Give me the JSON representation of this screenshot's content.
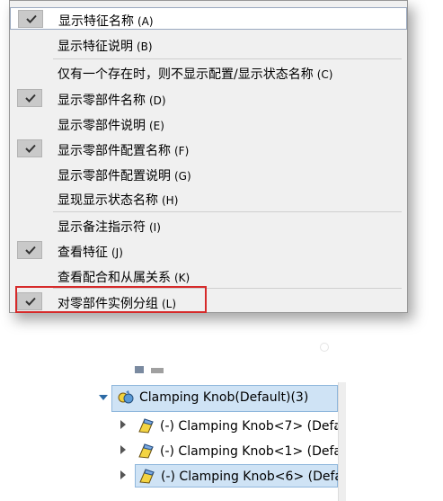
{
  "menu": {
    "items": [
      {
        "label": "显示特征名称",
        "accel": "(A)",
        "checked": true,
        "hover": true
      },
      {
        "label": "显示特征说明",
        "accel": "(B)",
        "checked": false
      },
      {
        "label": "仅有一个存在时，则不显示配置/显示状态名称",
        "accel": "(C)",
        "checked": false
      },
      {
        "label": "显示零部件名称",
        "accel": "(D)",
        "checked": true
      },
      {
        "label": "显示零部件说明",
        "accel": "(E)",
        "checked": false
      },
      {
        "label": "显示零部件配置名称",
        "accel": "(F)",
        "checked": true
      },
      {
        "label": "显示零部件配置说明",
        "accel": "(G)",
        "checked": false
      },
      {
        "label": "显现显示状态名称",
        "accel": "(H)",
        "checked": false
      },
      {
        "label": "显示备注指示符",
        "accel": "(I)",
        "checked": false
      },
      {
        "label": "查看特征",
        "accel": "(J)",
        "checked": true
      },
      {
        "label": "查看配合和从属关系",
        "accel": "(K)",
        "checked": false
      },
      {
        "label": "对零部件实例分组",
        "accel": "(L)",
        "checked": true
      }
    ]
  },
  "tree": {
    "parent": "Clamping Knob(Default)(3)",
    "children": [
      "(-) Clamping Knob<7> (Defa",
      "(-) Clamping Knob<1> (Defa",
      "(-) Clamping Knob<6> (Defa"
    ]
  },
  "colors": {
    "highlight": "#d62a2a",
    "selection": "#cfe3f5",
    "menu_bg": "#f0f0f0"
  }
}
